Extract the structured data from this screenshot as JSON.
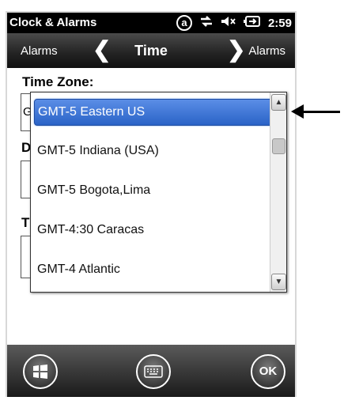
{
  "status_bar": {
    "app_title": "Clock & Alarms",
    "keyboard_indicator": "a",
    "time": "2:59",
    "icons": [
      "keyboard-mode-icon",
      "data-transfer-icon",
      "speaker-muted-icon",
      "battery-charging-icon"
    ]
  },
  "header": {
    "prev_label": "Alarms",
    "title": "Time",
    "next_label": "Alarms"
  },
  "form": {
    "time_zone_label": "Time Zone:",
    "time_zone_value_partial": "G",
    "date_label_partial": "D",
    "time_label_partial": "T"
  },
  "dropdown": {
    "items": [
      {
        "label": "GMT-5 Eastern US",
        "selected": true
      },
      {
        "label": "GMT-5 Indiana (USA)",
        "selected": false
      },
      {
        "label": "GMT-5 Bogota,Lima",
        "selected": false
      },
      {
        "label": "GMT-4:30 Caracas",
        "selected": false
      },
      {
        "label": "GMT-4 Atlantic",
        "selected": false
      }
    ]
  },
  "softkeys": {
    "ok_label": "OK"
  },
  "colors": {
    "selection": "#2a63c7",
    "status_bar": "#000000",
    "header": "#222222"
  }
}
